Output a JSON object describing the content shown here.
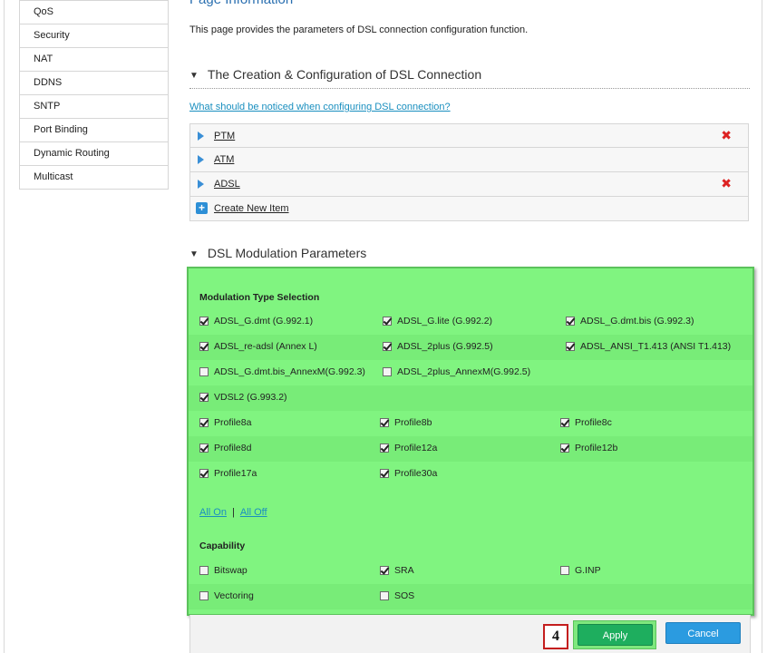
{
  "sidebar": {
    "items": [
      "QoS",
      "Security",
      "NAT",
      "DDNS",
      "SNTP",
      "Port Binding",
      "Dynamic Routing",
      "Multicast"
    ]
  },
  "page": {
    "title": "Page Information",
    "description": "This page provides the parameters of DSL connection configuration function."
  },
  "creation_section": {
    "title": "The Creation & Configuration of DSL Connection",
    "notice_link": "What should be noticed when configuring DSL connection?",
    "connections": [
      {
        "label": "PTM"
      },
      {
        "label": "ATM"
      },
      {
        "label": "ADSL"
      }
    ],
    "delete_symbol": "✖",
    "create_label": "Create New Item"
  },
  "modulation_section": {
    "title": "DSL Modulation Parameters",
    "type_heading": "Modulation Type Selection",
    "types": [
      {
        "label": "ADSL_G.dmt (G.992.1)",
        "checked": true
      },
      {
        "label": "ADSL_G.lite (G.992.2)",
        "checked": true
      },
      {
        "label": "ADSL_G.dmt.bis (G.992.3)",
        "checked": true
      },
      {
        "label": "ADSL_re-adsl (Annex L)",
        "checked": true
      },
      {
        "label": "ADSL_2plus (G.992.5)",
        "checked": true
      },
      {
        "label": "ADSL_ANSI_T1.413 (ANSI T1.413)",
        "checked": true
      },
      {
        "label": "ADSL_G.dmt.bis_AnnexM(G.992.3)",
        "checked": false
      },
      {
        "label": "ADSL_2plus_AnnexM(G.992.5)",
        "checked": false
      },
      {
        "label": "VDSL2 (G.993.2)",
        "checked": true
      }
    ],
    "profiles": [
      {
        "label": "Profile8a",
        "checked": true
      },
      {
        "label": "Profile8b",
        "checked": true
      },
      {
        "label": "Profile8c",
        "checked": true
      },
      {
        "label": "Profile8d",
        "checked": true
      },
      {
        "label": "Profile12a",
        "checked": true
      },
      {
        "label": "Profile12b",
        "checked": true
      },
      {
        "label": "Profile17a",
        "checked": true
      },
      {
        "label": "Profile30a",
        "checked": true
      }
    ],
    "all_on": "All On",
    "separator": "|",
    "all_off": "All Off",
    "capability_heading": "Capability",
    "capabilities": [
      {
        "label": "Bitswap",
        "checked": false
      },
      {
        "label": "SRA",
        "checked": true
      },
      {
        "label": "G.INP",
        "checked": false
      },
      {
        "label": "Vectoring",
        "checked": false
      },
      {
        "label": "SOS",
        "checked": false
      }
    ]
  },
  "actions": {
    "step": "4",
    "apply": "Apply",
    "cancel": "Cancel"
  },
  "colors": {
    "highlight": "#80f480",
    "apply": "#1eae5e",
    "cancel": "#2b9be0",
    "badge_border": "#c41e1e"
  }
}
